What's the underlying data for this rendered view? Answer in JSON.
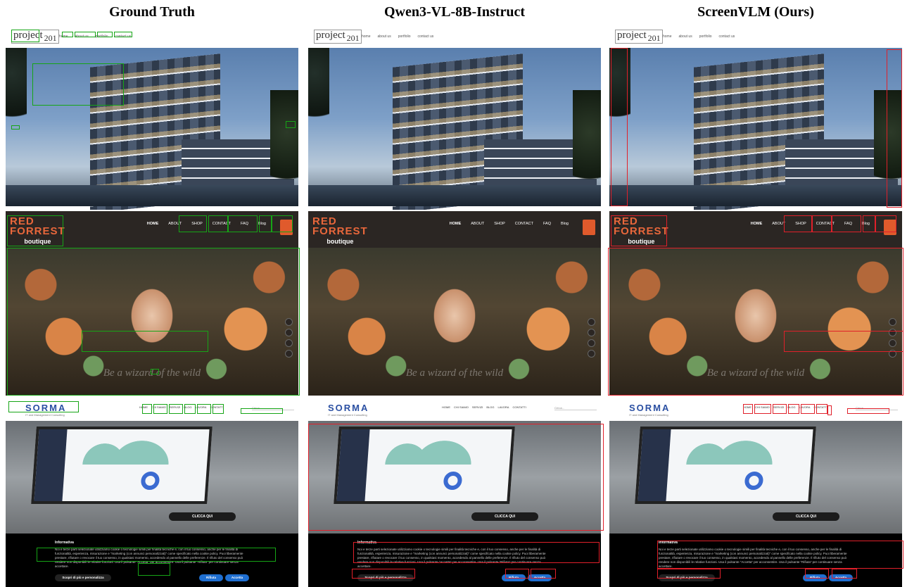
{
  "headers": [
    "Ground Truth",
    "Qwen3-VL-8B-Instruct",
    "ScreenVLM (Ours)"
  ],
  "project": {
    "logo": "project",
    "year": "201",
    "nav": [
      "home",
      "about us",
      "portfolio",
      "contact us"
    ]
  },
  "redforrest": {
    "logo_line1": "RED",
    "logo_line2": "FORREST",
    "logo_line3": "boutique",
    "menu": [
      "HOME",
      "ABOUT",
      "SHOP",
      "CONTACT",
      "FAQ",
      "Blog"
    ],
    "quote": "Be a wizard of the wild"
  },
  "sorma": {
    "logo": "SORMA",
    "logo_sub": "IT and Management Consulting",
    "menu": [
      "HOME",
      "CHI SIAMO",
      "SERVIZI",
      "BLOG",
      "LAVORA",
      "CONTATTI"
    ],
    "search_placeholder": "Cerca...",
    "cta": "CLICCA QUI",
    "cookie_title": "Informativa",
    "cookie_text": "Noi e terze parti selezionate utilizziamo cookie o tecnologie simili per finalità tecniche e, con il tuo consenso, anche per le finalità di funzionalità, esperienza, misurazione e “marketing (con annunci personalizzati)” come specificato nella cookie policy. Puoi liberamente prestare, rifiutare o revocare il tuo consenso, in qualsiasi momento, accedendo al pannello delle preferenze. Il rifiuto del consenso può rendere non disponibili le relative funzioni. Usa il pulsante “Accetta” per acconsentire. Usa il pulsante “Rifiuta” per continuare senza accettare.",
    "btn_more": "Scopri di più e personalizza",
    "btn_reject": "Rifiuta",
    "btn_accept": "Accetta"
  },
  "colors": {
    "ground_truth_box": "#16a516",
    "prediction_box": "#e0202a",
    "redforrest_accent": "#e8673b",
    "sorma_blue": "#2a4fa2",
    "cookie_button": "#1f6fd1"
  }
}
